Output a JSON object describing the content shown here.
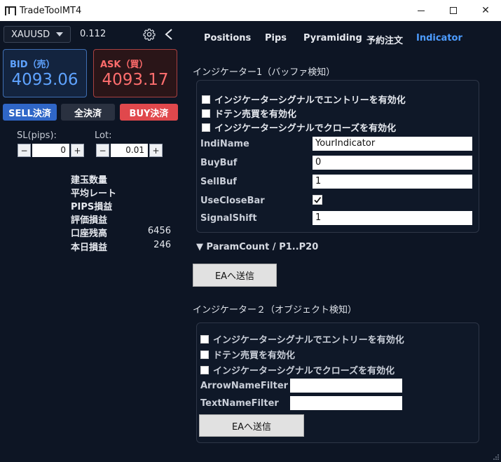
{
  "window": {
    "title": "TradeToolMT4"
  },
  "left": {
    "symbol": "XAUUSD",
    "spread": "0.112",
    "bid": {
      "label": "BID（売）",
      "value": "4093.06"
    },
    "ask": {
      "label": "ASK（買）",
      "value": "4093.17"
    },
    "buttons": {
      "sell_close": "SELL決済",
      "all_close": "全決済",
      "buy_close": "BUY決済"
    },
    "sl": {
      "label": "SL(pips):",
      "value": "0",
      "minus": "−",
      "plus": "+"
    },
    "lot": {
      "label": "Lot:",
      "value": "0.01",
      "minus": "−",
      "plus": "+"
    },
    "stats": [
      {
        "label": "建玉数量",
        "value": ""
      },
      {
        "label": "平均レート",
        "value": ""
      },
      {
        "label": "PIPS損益",
        "value": ""
      },
      {
        "label": "評価損益",
        "value": ""
      },
      {
        "label": "口座残高",
        "value": "6456"
      },
      {
        "label": "本日損益",
        "value": "246"
      }
    ]
  },
  "tabs": {
    "positions": "Positions",
    "pips": "Pips",
    "pyramiding": "Pyramiding",
    "yoyaku": "予約注文",
    "indicator": "Indicator",
    "active": "Indicator",
    "active_color": "#4d9cff"
  },
  "indicator1": {
    "title": "インジケーター1（バッファ検知）",
    "checkboxes": [
      {
        "label": "インジケーターシグナルでエントリーを有効化",
        "checked": false
      },
      {
        "label": "ドテン売買を有効化",
        "checked": false
      },
      {
        "label": "インジケーターシグナルでクローズを有効化",
        "checked": false
      }
    ],
    "fields": {
      "indi_name": {
        "label": "IndiName",
        "value": "YourIndicator"
      },
      "buy_buf": {
        "label": "BuyBuf",
        "value": "0"
      },
      "sell_buf": {
        "label": "SellBuf",
        "value": "1"
      },
      "use_close_bar": {
        "label": "UseCloseBar",
        "checked": true
      },
      "signal_shift": {
        "label": "SignalShift",
        "value": "1"
      }
    },
    "param_toggle": "▼ ParamCount / P1..P20",
    "send_button": "EAへ送信"
  },
  "indicator2": {
    "title": "インジケーター２（オブジェクト検知）",
    "checkboxes": [
      {
        "label": "インジケーターシグナルでエントリーを有効化",
        "checked": false
      },
      {
        "label": "ドテン売買を有効化",
        "checked": false
      },
      {
        "label": "インジケーターシグナルでクローズを有効化",
        "checked": false
      }
    ],
    "fields": {
      "arrow_name_filter": {
        "label": "ArrowNameFilter",
        "value": ""
      },
      "text_name_filter": {
        "label": "TextNameFilter",
        "value": ""
      }
    },
    "send_button": "EAへ送信"
  }
}
